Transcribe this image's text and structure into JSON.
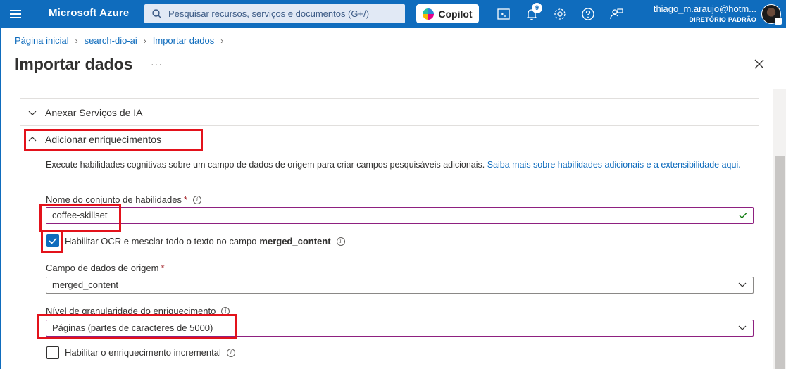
{
  "topbar": {
    "brand": "Microsoft Azure",
    "search_placeholder": "Pesquisar recursos, serviços e documentos (G+/)",
    "copilot_label": "Copilot",
    "notifications_count": "9",
    "user_name": "thiago_m.araujo@hotm...",
    "directory": "DIRETÓRIO PADRÃO",
    "accent_color": "#0f6cbd"
  },
  "breadcrumb": {
    "items": [
      "Página inicial",
      "search-dio-ai",
      "Importar dados"
    ]
  },
  "page": {
    "title": "Importar dados",
    "more": "···"
  },
  "sections": {
    "attach_ai": "Anexar Serviços de IA",
    "add_enrichments": "Adicionar enriquecimentos"
  },
  "description": {
    "text": "Execute habilidades cognitivas sobre um campo de dados de origem para criar campos pesquisáveis adicionais. ",
    "link": "Saiba mais sobre habilidades adicionais e a extensibilidade aqui."
  },
  "form": {
    "skillset_label": "Nome do conjunto de habilidades",
    "skillset_value": "coffee-skillset",
    "ocr_label_prefix": "Habilitar OCR e mesclar todo o texto no campo",
    "ocr_label_field": "merged_content",
    "ocr_checked": true,
    "source_field_label": "Campo de dados de origem",
    "source_field_value": "merged_content",
    "granularity_label": "Nível de granularidade do enriquecimento",
    "granularity_value": "Páginas (partes de caracteres de 5000)",
    "incremental_label": "Habilitar o enriquecimento incremental",
    "incremental_checked": false,
    "required_mark": "*"
  }
}
